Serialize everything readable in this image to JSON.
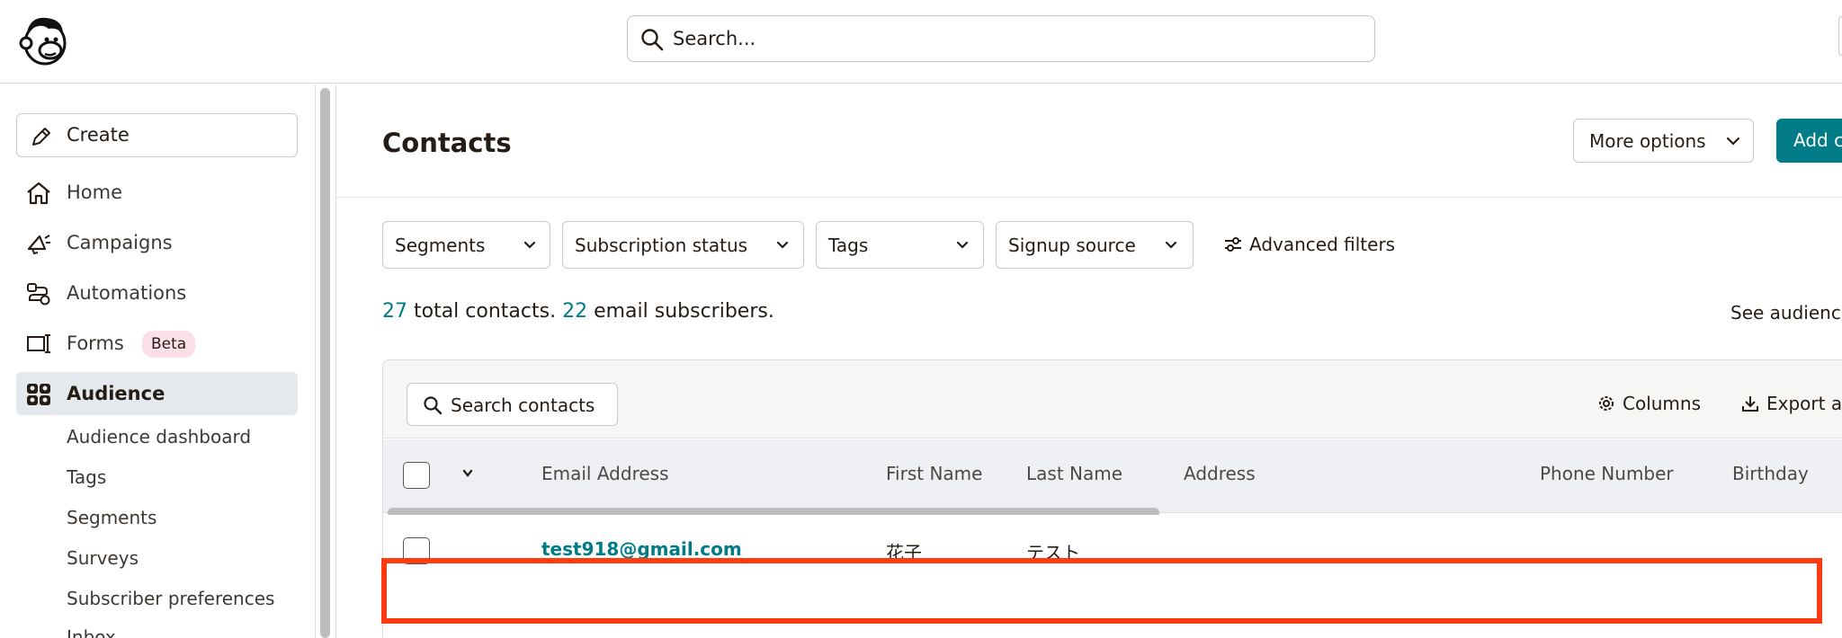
{
  "app": {
    "search_placeholder": "Search..."
  },
  "sidebar": {
    "create_label": "Create",
    "items": [
      {
        "label": "Home",
        "icon": "home-icon"
      },
      {
        "label": "Campaigns",
        "icon": "megaphone-icon"
      },
      {
        "label": "Automations",
        "icon": "automations-icon"
      },
      {
        "label": "Forms",
        "icon": "forms-icon",
        "badge": "Beta"
      },
      {
        "label": "Audience",
        "icon": "audience-icon",
        "active": true
      }
    ],
    "audience_subitems": [
      "Audience dashboard",
      "Tags",
      "Segments",
      "Surveys",
      "Subscriber preferences",
      "Inbox"
    ]
  },
  "page": {
    "title": "Contacts",
    "more_options_label": "More options",
    "add_contacts_label": "Add contacts"
  },
  "filters": {
    "segments": "Segments",
    "subscription_status": "Subscription status",
    "tags": "Tags",
    "signup_source": "Signup source",
    "advanced": "Advanced filters"
  },
  "summary": {
    "total_count": "27",
    "total_text": " total contacts. ",
    "email_count": "22",
    "email_text": " email subscribers.",
    "see_audience": "See audience stats"
  },
  "table": {
    "search_label": "Search contacts",
    "columns_label": "Columns",
    "export_label": "Export audience",
    "headers": [
      "Email Address",
      "First Name",
      "Last Name",
      "Address",
      "Phone Number",
      "Birthday"
    ],
    "rows": [
      {
        "email": "test918@gmail.com",
        "first_name": "花子",
        "last_name": "テスト",
        "address": "",
        "phone": "",
        "birthday": ""
      }
    ]
  },
  "colors": {
    "accent": "#007c89",
    "highlight": "#ff3b12",
    "active_nav": "#e5e8ed"
  }
}
